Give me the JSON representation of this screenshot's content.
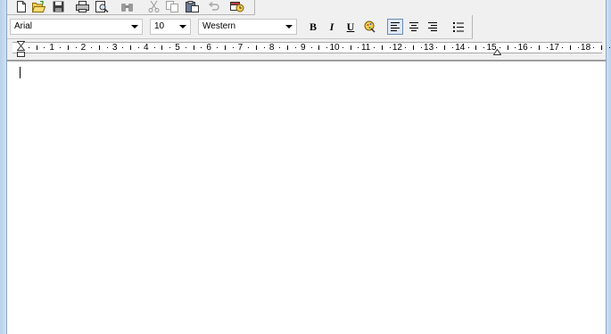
{
  "toolbar": {
    "buttons": [
      {
        "name": "new-document-icon"
      },
      {
        "name": "open-folder-icon"
      },
      {
        "name": "save-disk-icon"
      },
      {
        "name": "print-icon"
      },
      {
        "name": "print-preview-icon"
      },
      {
        "name": "find-binoculars-icon"
      },
      {
        "name": "cut-scissors-icon"
      },
      {
        "name": "copy-icon"
      },
      {
        "name": "paste-icon"
      },
      {
        "name": "undo-icon"
      },
      {
        "name": "insert-date-time-icon"
      }
    ]
  },
  "format": {
    "font_name": "Arial",
    "font_size": "10",
    "script": "Western",
    "bold_label": "B",
    "italic_label": "I",
    "underline_label": "U"
  },
  "ruler": {
    "labels": [
      "1",
      "2",
      "3",
      "4",
      "5",
      "6",
      "7",
      "8",
      "9",
      "10",
      "11",
      "12",
      "13",
      "14",
      "15",
      "16",
      "17",
      "18"
    ]
  },
  "colors": {
    "window_frame": "#cfe0f3",
    "toolbar_bg": "#f0f0f0",
    "document_bg": "#ffffff",
    "active_button_border": "#6b8bb5"
  }
}
